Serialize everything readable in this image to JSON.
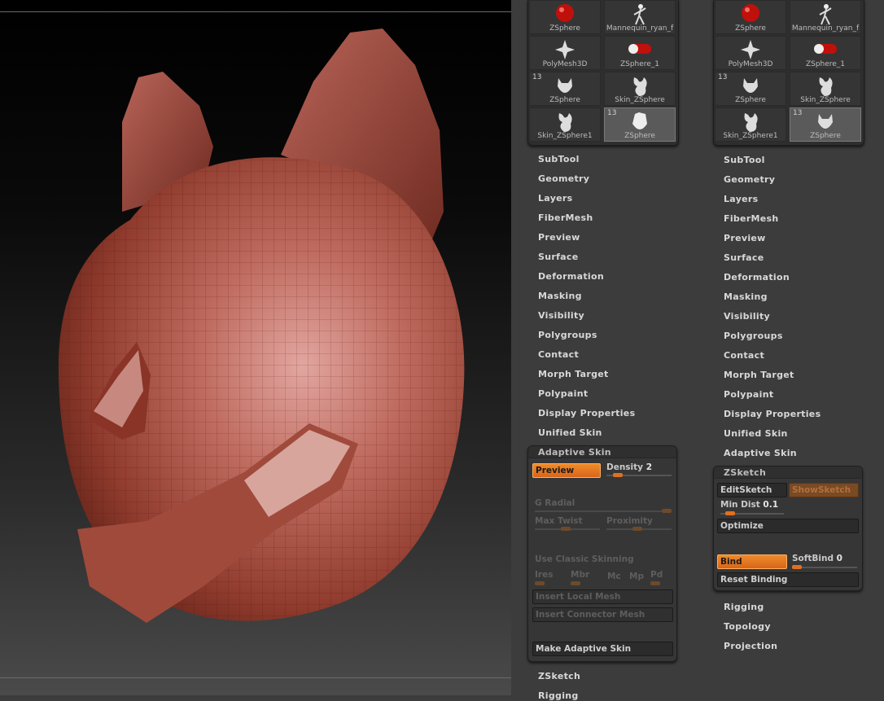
{
  "viewport": {
    "model_color": "#9a3c30"
  },
  "left_panel": {
    "thumbnails": [
      {
        "label": "ZSphere",
        "icon": "zsphere-red-icon"
      },
      {
        "label": "Mannequin_ryan_f",
        "icon": "mannequin-icon"
      },
      {
        "label": "PolyMesh3D",
        "icon": "polymesh-star-icon"
      },
      {
        "label": "ZSphere_1",
        "icon": "zsphere-capsule-icon"
      },
      {
        "label": "ZSphere",
        "badge": "13",
        "icon": "zsphere-mesh-icon"
      },
      {
        "label": "Skin_ZSphere",
        "icon": "skin-mesh-icon"
      },
      {
        "label": "Skin_ZSphere1",
        "icon": "skin-mesh-icon"
      },
      {
        "label": "ZSphere",
        "badge": "13",
        "icon": "zsphere-mesh-icon",
        "selected": true
      }
    ],
    "menu_items": [
      "SubTool",
      "Geometry",
      "Layers",
      "FiberMesh",
      "Preview",
      "Surface",
      "Deformation",
      "Masking",
      "Visibility",
      "Polygroups",
      "Contact",
      "Morph Target",
      "Polypaint",
      "Display Properties",
      "Unified Skin"
    ],
    "adaptive_skin": {
      "title": "Adaptive Skin",
      "preview": "Preview",
      "density_label": "Density",
      "density_value": "2",
      "density": 0.2,
      "g_radial": "G Radial",
      "max_twist": "Max Twist",
      "proximity": "Proximity",
      "use_classic": "Use Classic Skinning",
      "ires": "Ires",
      "mbr": "Mbr",
      "mc": "Mc",
      "mp": "Mp",
      "pd": "Pd",
      "insert_local": "Insert Local Mesh",
      "insert_connector": "Insert Connector Mesh",
      "make_adaptive": "Make Adaptive Skin"
    },
    "after_items": [
      "ZSketch",
      "Rigging"
    ]
  },
  "right_panel": {
    "thumbnails": [
      {
        "label": "ZSphere",
        "icon": "zsphere-red-icon"
      },
      {
        "label": "Mannequin_ryan_f",
        "icon": "mannequin-icon"
      },
      {
        "label": "PolyMesh3D",
        "icon": "polymesh-star-icon"
      },
      {
        "label": "ZSphere_1",
        "icon": "zsphere-capsule-icon"
      },
      {
        "label": "ZSphere",
        "badge": "13",
        "icon": "zsphere-mesh-icon"
      },
      {
        "label": "Skin_ZSphere",
        "icon": "skin-mesh-icon"
      },
      {
        "label": "Skin_ZSphere1",
        "icon": "skin-mesh-icon"
      },
      {
        "label": "ZSphere",
        "badge": "13",
        "icon": "zsphere-mesh-icon",
        "selected": true
      }
    ],
    "menu_items": [
      "SubTool",
      "Geometry",
      "Layers",
      "FiberMesh",
      "Preview",
      "Surface",
      "Deformation",
      "Masking",
      "Visibility",
      "Polygroups",
      "Contact",
      "Morph Target",
      "Polypaint",
      "Display Properties",
      "Unified Skin",
      "Adaptive Skin"
    ],
    "zsketch": {
      "title": "ZSketch",
      "edit_sketch": "EditSketch",
      "show_sketch": "ShowSketch",
      "min_dist_label": "Min Dist",
      "min_dist_value": "0.1",
      "min_dist": 0.1,
      "optimize": "Optimize",
      "bind": "Bind",
      "softbind_label": "SoftBind",
      "softbind_value": "0",
      "softbind": 0,
      "reset_binding": "Reset Binding"
    },
    "after_items": [
      "Rigging",
      "Topology",
      "Projection"
    ]
  }
}
